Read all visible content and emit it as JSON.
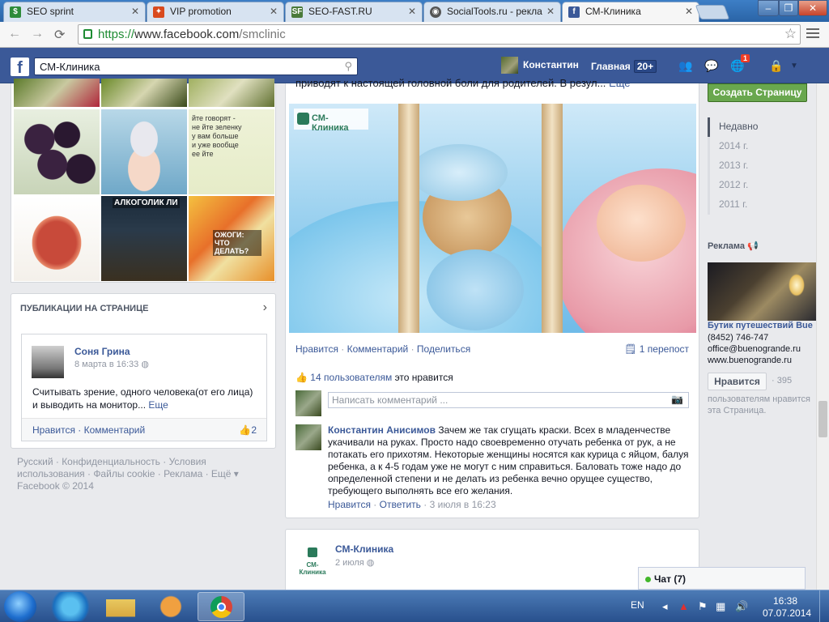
{
  "browser": {
    "tabs": [
      {
        "label": "SEO sprint",
        "icon": "seosprint-icon",
        "color": "#2e8b3a"
      },
      {
        "label": "VIP promotion",
        "icon": "vip-icon",
        "color": "#d94a1e"
      },
      {
        "label": "SEO-FAST.RU",
        "icon": "sf-icon",
        "color": "#4a7a3a"
      },
      {
        "label": "SocialTools.ru - рекла",
        "icon": "socialtools-icon",
        "color": "#555555"
      },
      {
        "label": "СМ-Клиника",
        "icon": "facebook-icon",
        "color": "#3b5998"
      }
    ],
    "url_scheme": "https://",
    "url_host": "www.facebook.com",
    "url_path": "/smclinic"
  },
  "fb": {
    "logo": "f",
    "search_value": "СМ-Клиника",
    "user_name": "Константин",
    "home_label": "Главная",
    "home_badge": "20+",
    "notif_count": "1"
  },
  "photos": {
    "labels": [
      "",
      "",
      "",
      "",
      "",
      "",
      "",
      "АЛКОГОЛИК ЛИ",
      "ОЖОГИ: ЧТО ДЕЛАТЬ?"
    ],
    "text_snippets": [
      "йте говорят - не йте зеленку у вам больше и уже вообще ее йте"
    ]
  },
  "pubs": {
    "title": "ПУБЛИКАЦИИ НА СТРАНИЦЕ",
    "author": "Соня Грина",
    "date": "8 марта в 16:33",
    "text": "Считывать зрение, одного человека(от его лица) и выводить на монитор...",
    "more": "Еще",
    "like": "Нравится",
    "comment": "Комментарий",
    "likes_count": "2"
  },
  "footer": {
    "links": "Русский · Конфиденциальность · Условия использования · Файлы cookie · Реклама · Ещё ▾",
    "copyright": "Facebook © 2014"
  },
  "post": {
    "truncated": "приводят к настоящей головной боли для родителей. В резул...",
    "truncated_more": "Еще",
    "image_logo": "СМ-Клиника",
    "action_like": "Нравится",
    "action_comment": "Комментарий",
    "action_share": "Поделиться",
    "reposts": "1 перепост",
    "likes_link": "14 пользователям",
    "likes_rest": "это нравится",
    "comment_placeholder": "Написать комментарий ...",
    "comment_author": "Константин Анисимов",
    "comment_text": "Зачем же так сгущать краски. Всех в младенчестве укачивали на руках. Просто надо своевременно отучать ребенка от рук, а не потакать его прихотям. Некоторые женщины носятся как курица с яйцом, балуя ребенка, а к 4-5 годам уже не могут с ним справиться. Баловать тоже надо до определенной степени и не делать из ребенка вечно орущее существо, требующего выполнять все его желания.",
    "comment_like": "Нравится",
    "comment_reply": "Ответить",
    "comment_time": "3 июля в 16:23"
  },
  "post2": {
    "logo": "СМ-Клиника",
    "name": "СМ-Клиника",
    "date": "2 июля"
  },
  "right": {
    "create_page": "Создать Страницу",
    "years": [
      "Недавно",
      "2014 г.",
      "2013 г.",
      "2012 г.",
      "2011 г."
    ],
    "ads_title": "Реклама",
    "ad_title": "Бутик путешествий Bue",
    "ad_phone": "(8452) 746-747",
    "ad_email": "office@buenogrande.ru",
    "ad_site": "www.buenogrande.ru",
    "ad_like": "Нравится",
    "ad_count": "· 395",
    "ad_count_text": "пользователям нравится эта Страница."
  },
  "chat": {
    "label": "Чат (7)"
  },
  "taskbar": {
    "lang": "EN",
    "time": "16:38",
    "date": "07.07.2014"
  }
}
